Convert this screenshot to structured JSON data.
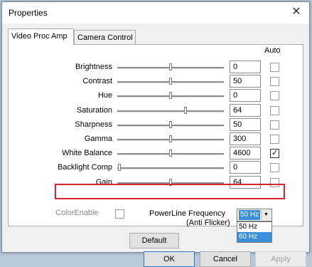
{
  "window": {
    "title": "Properties"
  },
  "tabs": [
    {
      "label": "Video Proc Amp",
      "active": true
    },
    {
      "label": "Camera Control",
      "active": false
    }
  ],
  "auto_header": "Auto",
  "controls": [
    {
      "label": "Brightness",
      "value": "0",
      "level": 0.5,
      "auto": false,
      "disabled": false
    },
    {
      "label": "Contrast",
      "value": "50",
      "level": 0.5,
      "auto": false,
      "disabled": false
    },
    {
      "label": "Hue",
      "value": "0",
      "level": 0.5,
      "auto": false,
      "disabled": false
    },
    {
      "label": "Saturation",
      "value": "64",
      "level": 0.64,
      "auto": false,
      "disabled": false
    },
    {
      "label": "Sharpness",
      "value": "50",
      "level": 0.5,
      "auto": false,
      "disabled": false
    },
    {
      "label": "Gamma",
      "value": "300",
      "level": 0.5,
      "auto": false,
      "disabled": false
    },
    {
      "label": "White Balance",
      "value": "4600",
      "level": 0.5,
      "auto": true,
      "disabled": false,
      "highlighted": true
    },
    {
      "label": "Backlight Comp",
      "value": "0",
      "level": 0.02,
      "auto": false,
      "disabled": false
    },
    {
      "label": "Gain",
      "value": "64",
      "level": 0.5,
      "auto": false,
      "disabled": false
    }
  ],
  "color_enable": {
    "label": "ColorEnable",
    "checked": false,
    "disabled": true
  },
  "powerline": {
    "label_line1": "PowerLine Frequency",
    "label_line2": "(Anti Flicker)",
    "selected": "50 Hz",
    "options": [
      {
        "label": "50 Hz",
        "highlighted": false
      },
      {
        "label": "60 Hz",
        "highlighted": true
      }
    ]
  },
  "buttons": {
    "default": "Default",
    "ok": "OK",
    "cancel": "Cancel",
    "apply": "Apply"
  },
  "icons": {
    "close": "close-icon",
    "checkmark": "checkmark-icon",
    "dropdown_arrow": "dropdown-arrow-icon"
  },
  "colors": {
    "highlight_border": "#d9232d",
    "selection": "#3a8fd8"
  }
}
